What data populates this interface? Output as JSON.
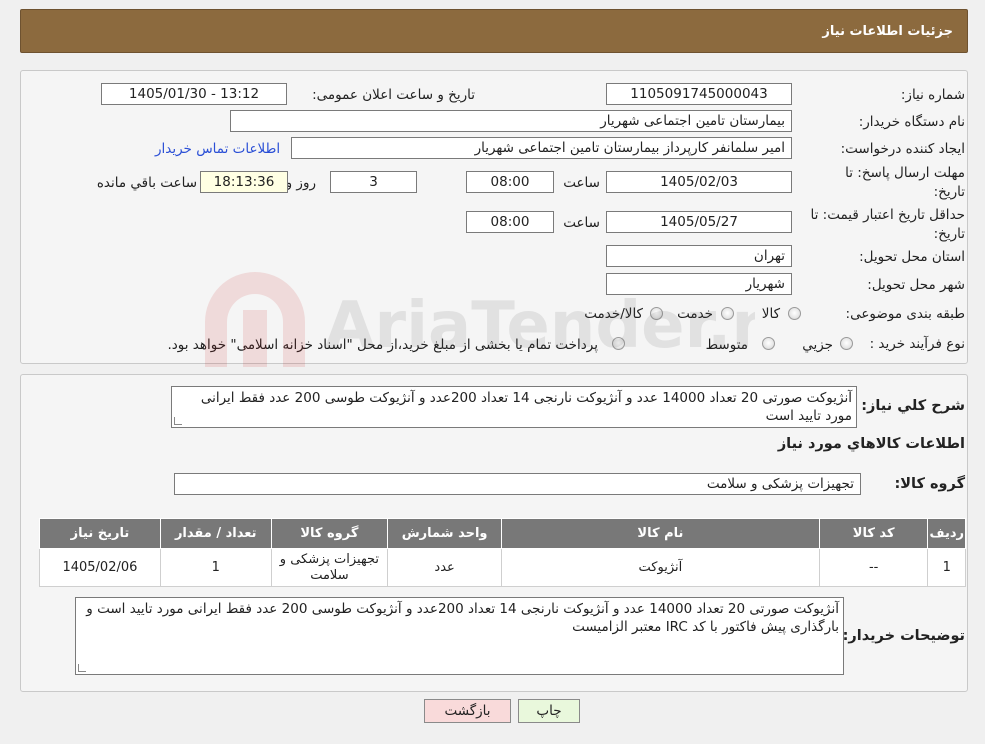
{
  "header": {
    "title": "جزئیات اطلاعات نیاز"
  },
  "form": {
    "need_number_label": "شماره نیاز:",
    "need_number": "1105091745000043",
    "announce_label": "تاریخ و ساعت اعلان عمومی:",
    "announce_value": "1405/01/30 - 13:12",
    "buyer_org_label": "نام دستگاه خریدار:",
    "buyer_org": "بیمارستان تامین اجتماعی شهریار",
    "creator_label": "ایجاد کننده درخواست:",
    "creator": "امیر سلمانفر کارپرداز بیمارستان تامین اجتماعی شهریار",
    "contact_link": "اطلاعات تماس خریدار",
    "deadline_label_1": "مهلت ارسال پاسخ: تا",
    "deadline_label_2": "تاریخ:",
    "deadline_date": "1405/02/03",
    "time_label": "ساعت",
    "deadline_time": "08:00",
    "days_value": "3",
    "days_label": "روز و",
    "remaining_time": "18:13:36",
    "remaining_label": "ساعت باقي مانده",
    "validity_label_1": "حداقل تاریخ اعتبار قیمت: تا",
    "validity_label_2": "تاریخ:",
    "validity_date": "1405/05/27",
    "validity_time": "08:00",
    "province_label": "استان محل تحویل:",
    "province": "تهران",
    "city_label": "شهر محل تحویل:",
    "city": "شهریار",
    "category_label": "طبقه بندی موضوعی:",
    "category_options": [
      "کالا",
      "خدمت",
      "کالا/خدمت"
    ],
    "process_label": "نوع فرآیند خرید :",
    "process_options": [
      "جزیي",
      "متوسط"
    ],
    "process_note": "پرداخت تمام یا بخشی از مبلغ خرید،از محل \"اسناد خزانه اسلامی\" خواهد بود."
  },
  "details": {
    "summary_label": "شرح کلي نياز:",
    "summary_text": "آنژیوکت صورتی 20 تعداد 14000 عدد و آنژیوکت نارنجی 14 تعداد 200عدد و آنژیوکت طوسی 200 عدد فقط ایرانی مورد تایید است",
    "goods_info_title": "اطلاعات کالاهاي مورد نياز",
    "goods_group_label": "گروه کالا:",
    "goods_group": "تجهیزات پزشکی و سلامت",
    "table": {
      "headers": [
        "رديف",
        "کد کالا",
        "نام کالا",
        "واحد شمارش",
        "گروه کالا",
        "تعداد / مقدار",
        "تاریخ نیاز"
      ],
      "rows": [
        [
          "1",
          "--",
          "آنژیوکت",
          "عدد",
          "تجهیزات پزشکی و سلامت",
          "1",
          "1405/02/06"
        ]
      ]
    },
    "buyer_notes_label": "توضیحات خریدار:",
    "buyer_notes": "آنژیوکت صورتی 20 تعداد 14000 عدد و آنژیوکت نارنجی 14 تعداد 200عدد و آنژیوکت طوسی 200 عدد فقط ایرانی مورد تایید است و بارگذاری پیش فاکتور با کد IRC معتبر الزامیست"
  },
  "buttons": {
    "print": "چاپ",
    "back": "بازگشت"
  },
  "watermark": {
    "text": "AriaTender.neT"
  },
  "colors": {
    "header_bg": "#8c6a3e",
    "link": "#2a4fd6",
    "table_header": "#787878"
  }
}
